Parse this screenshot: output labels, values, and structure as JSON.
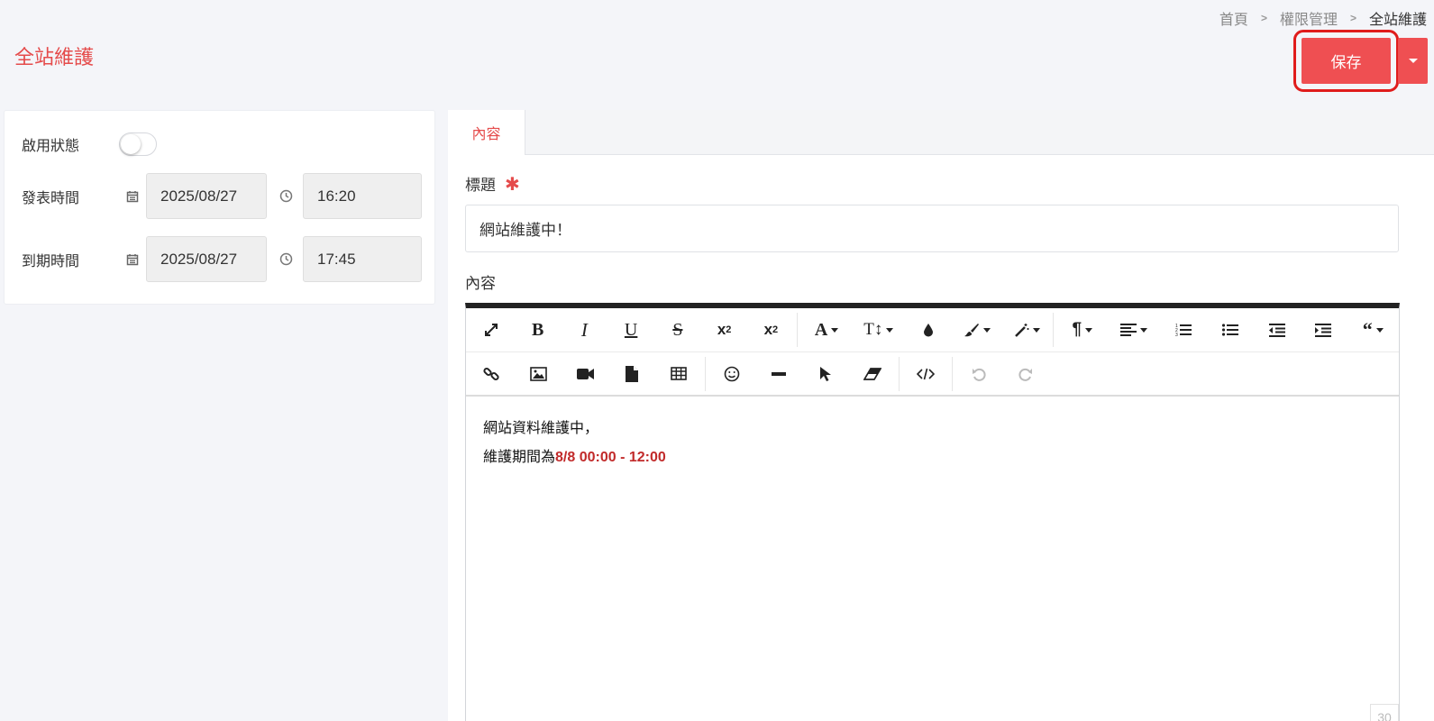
{
  "breadcrumb": {
    "home": "首頁",
    "section": "權限管理",
    "current": "全站維護"
  },
  "page_title": "全站維護",
  "actions": {
    "save_label": "保存"
  },
  "settings": {
    "enable_label": "啟用狀態",
    "publish_label": "發表時間",
    "publish_date": "2025/08/27",
    "publish_time": "16:20",
    "expire_label": "到期時間",
    "expire_date": "2025/08/27",
    "expire_time": "17:45"
  },
  "tabs": [
    {
      "label": "內容"
    }
  ],
  "form": {
    "title_label": "標題",
    "required_mark": "✱",
    "title_value": "網站維護中！",
    "content_label": "內容"
  },
  "editor": {
    "line1": "網站資料維護中，",
    "line2_prefix": "維護期間為",
    "line2_highlight": "8/8 00:00 - 12:00",
    "char_count": "30"
  },
  "colors": {
    "accent": "#e54b4b",
    "button": "#ef4f52",
    "highlight_box": "#e01c1c",
    "content_highlight": "#c12a2a"
  }
}
